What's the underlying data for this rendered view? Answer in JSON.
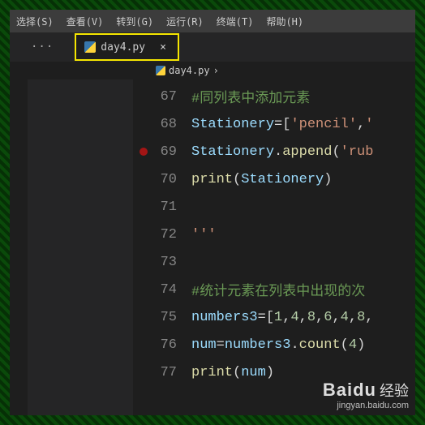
{
  "menu": [
    "选择(S)",
    "查看(V)",
    "转到(G)",
    "运行(R)",
    "终端(T)",
    "帮助(H)"
  ],
  "tab": {
    "dots": "···",
    "icon": "python-icon",
    "label": "day4.py",
    "close": "×"
  },
  "breadcrumb": {
    "icon": "python-icon",
    "label": "day4.py",
    "sep": "›"
  },
  "lines": [
    {
      "n": 67,
      "type": "comment",
      "text": "#同列表中添加元素"
    },
    {
      "n": 68,
      "type": "code68"
    },
    {
      "n": 69,
      "type": "code69",
      "bp": true
    },
    {
      "n": 70,
      "type": "code70"
    },
    {
      "n": 71,
      "type": "blank"
    },
    {
      "n": 72,
      "type": "str",
      "text": "'''"
    },
    {
      "n": 73,
      "type": "blank"
    },
    {
      "n": 74,
      "type": "comment",
      "text": "#统计元素在列表中出现的次"
    },
    {
      "n": 75,
      "type": "code75"
    },
    {
      "n": 76,
      "type": "code76"
    },
    {
      "n": 77,
      "type": "code77"
    }
  ],
  "c": {
    "stationery": "Stationery",
    "eq": "=",
    "lb": "[",
    "rb": "]",
    "lp": "(",
    "rp": ")",
    "dot": ".",
    "comma": ",",
    "pencil": "'pencil'",
    "tail": "'",
    "append": "append",
    "rub": "'rub",
    "print": "print",
    "numbers3": "numbers3",
    "nums": [
      "1",
      "4",
      "8",
      "6",
      "4",
      "8"
    ],
    "num": "num",
    "count": "count",
    "four": "4"
  },
  "watermark": {
    "brand": "Bai",
    "du": "d",
    "u": "u",
    "cn": "经验",
    "url": "jingyan.baidu.com"
  }
}
